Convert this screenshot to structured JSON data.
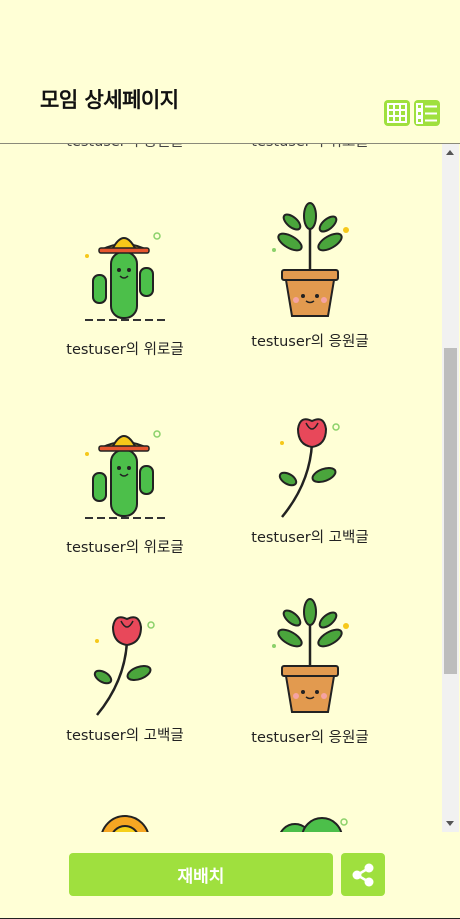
{
  "header": {
    "title": "모임 상세페이지",
    "grid_view_icon": "grid-icon",
    "list_view_icon": "list-icon"
  },
  "cards": [
    {
      "caption": "testuser의 위로글",
      "art": "cactus-sombrero"
    },
    {
      "caption": "testuser의 응원글",
      "art": "potted-plant"
    },
    {
      "caption": "testuser의 위로글",
      "art": "cactus-sombrero"
    },
    {
      "caption": "testuser의 고백글",
      "art": "rose"
    },
    {
      "caption": "testuser의 고백글",
      "art": "rose"
    },
    {
      "caption": "testuser의 응원글",
      "art": "potted-plant"
    }
  ],
  "footer": {
    "rearrange_label": "재배치",
    "share_icon": "share-icon"
  },
  "colors": {
    "background": "#ffffd6",
    "accent": "#9fe03e"
  }
}
